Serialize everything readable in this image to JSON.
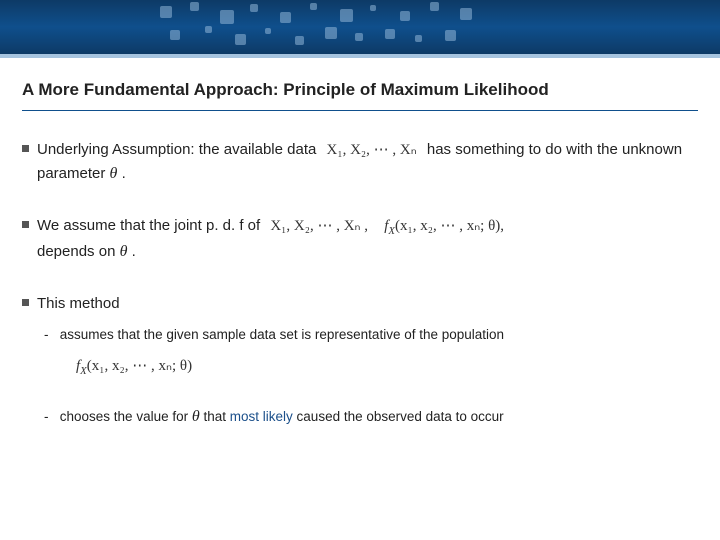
{
  "title": "A More Fundamental Approach: Principle of Maximum Likelihood",
  "b1a": "Underlying Assumption: the available data ",
  "b1seq": "X₁, X₂, ⋯ , Xₙ",
  "b1b": " has something to do with the unknown parameter ",
  "b1c": " .",
  "theta": "θ",
  "b2a": "We assume that the joint p. d. f of ",
  "b2seq": "X₁, X₂, ⋯ , Xₙ ,",
  "b2pdf": "f",
  "b2pdf_sub": "X",
  "b2args": "(x₁, x₂, ⋯ , xₙ; θ),",
  "b2b": "depends on ",
  "b2c": ".",
  "b3": "This method",
  "s1": "assumes that the given sample data set is representative of the population",
  "formula_f": "f",
  "formula_sub": "X",
  "formula_args": "(x₁, x₂, ⋯ , xₙ; θ)",
  "s2a": "chooses the value for ",
  "s2b": " that ",
  "s2emph": "most likely",
  "s2c": " caused the observed data to occur"
}
